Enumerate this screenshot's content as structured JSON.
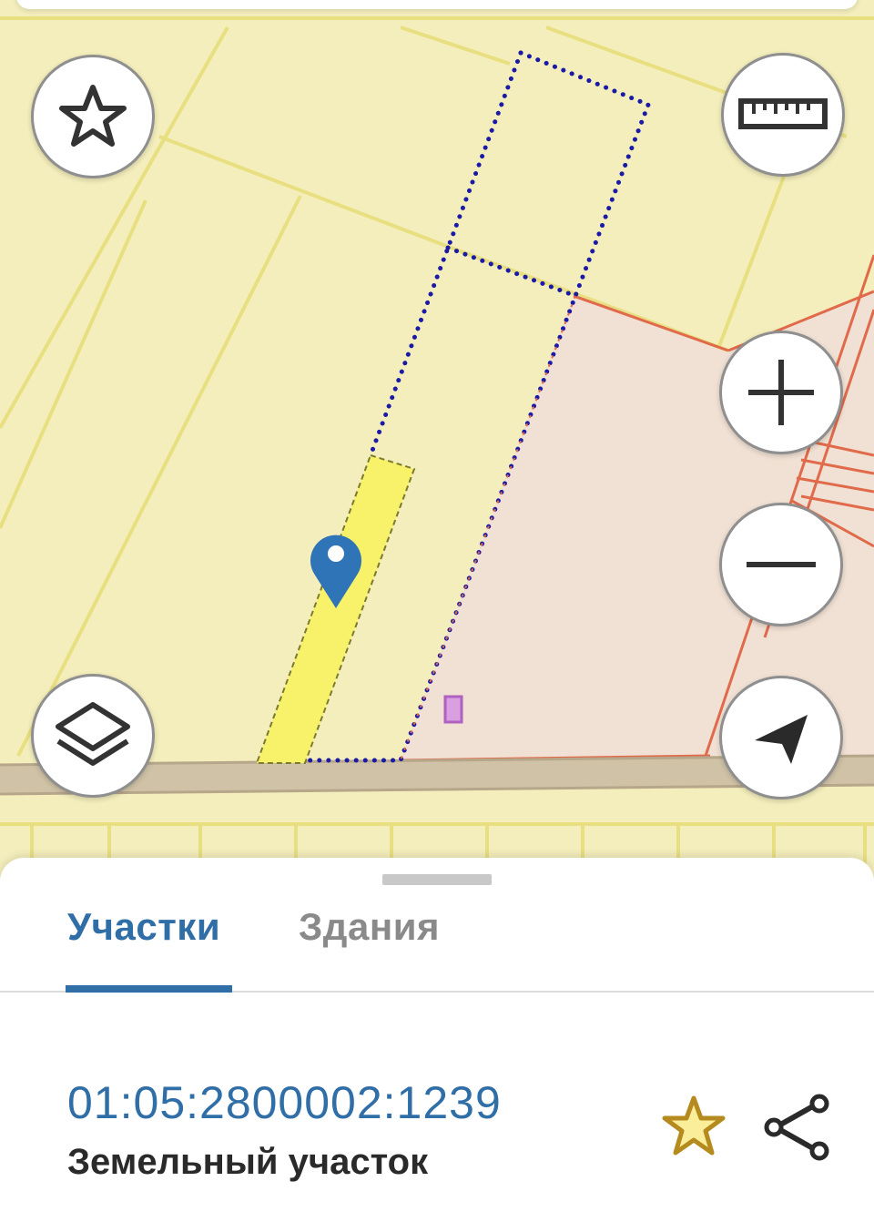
{
  "map": {
    "controls": {
      "favorites": "star-icon",
      "ruler": "ruler-icon",
      "zoom_in": "plus-icon",
      "zoom_out": "minus-icon",
      "layers": "layers-icon",
      "locate": "navigation-arrow-icon"
    },
    "colors": {
      "background": "#f4eebc",
      "parcel_border": "#e8df80",
      "highlighted_parcel": "#f8f26a",
      "selected_outline": "#1a1aa6",
      "zone_fill": "#f1e1d4",
      "zone_border": "#e06a4a",
      "road": "#c8b89a",
      "marker": "#2f74b6"
    }
  },
  "sheet": {
    "tabs": [
      {
        "label": "Участки",
        "active": true
      },
      {
        "label": "Здания",
        "active": false
      }
    ],
    "parcel": {
      "cadastral_number": "01:05:2800002:1239",
      "type": "Земельный участок"
    },
    "actions": {
      "favorite": "star-outline-icon",
      "share": "share-icon"
    },
    "accent_color": "#2f6ea6"
  }
}
